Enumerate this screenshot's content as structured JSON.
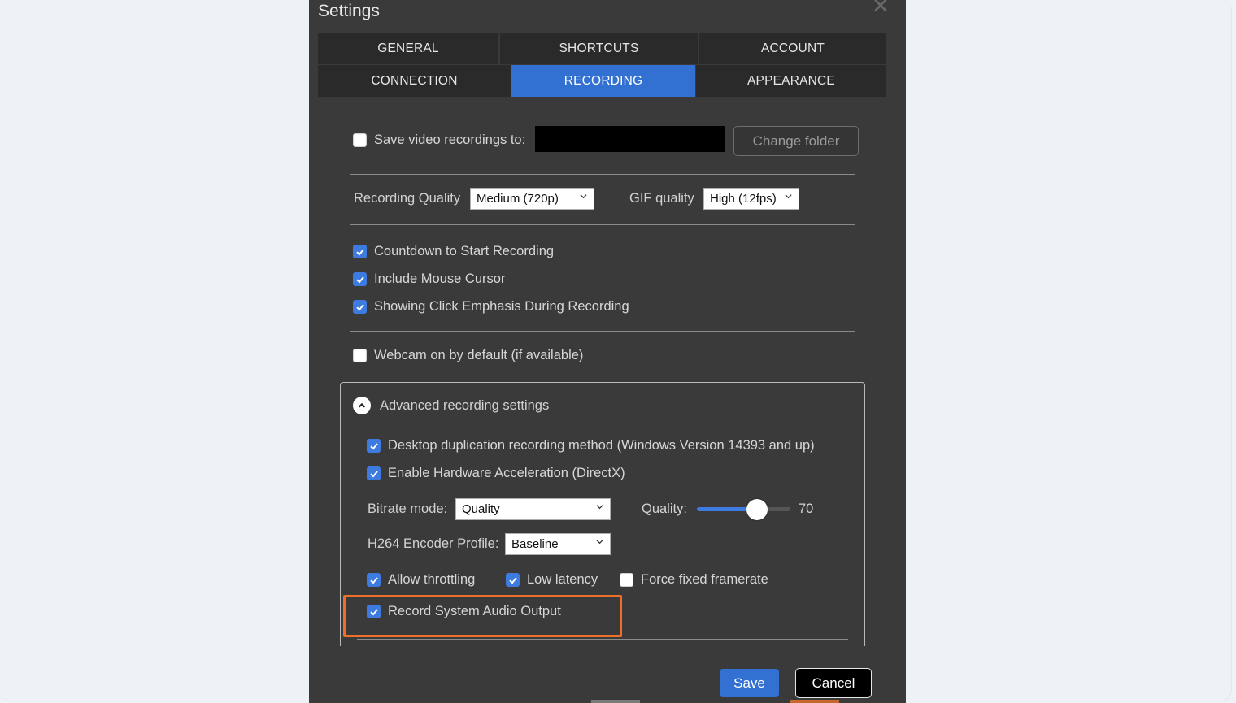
{
  "dialog": {
    "title": "Settings"
  },
  "tabs": [
    {
      "label": "GENERAL",
      "active": false
    },
    {
      "label": "SHORTCUTS",
      "active": false
    },
    {
      "label": "ACCOUNT",
      "active": false
    },
    {
      "label": "CONNECTION",
      "active": false
    },
    {
      "label": "RECORDING",
      "active": true
    },
    {
      "label": "APPEARANCE",
      "active": false
    }
  ],
  "save_path": {
    "label": "Save video recordings to:",
    "checked": false,
    "change_folder_label": "Change folder"
  },
  "quality": {
    "recording_label": "Recording Quality",
    "recording_value": "Medium (720p)",
    "gif_label": "GIF quality",
    "gif_value": "High (12fps)"
  },
  "options": {
    "countdown": {
      "label": "Countdown to Start Recording",
      "checked": true
    },
    "mouse_cursor": {
      "label": "Include Mouse Cursor",
      "checked": true
    },
    "click_emphasis": {
      "label": "Showing Click Emphasis During Recording",
      "checked": true
    },
    "webcam": {
      "label": "Webcam on by default (if available)",
      "checked": false
    }
  },
  "advanced": {
    "title": "Advanced recording settings",
    "desktop_duplication": {
      "label": "Desktop duplication recording method (Windows Version 14393 and up)",
      "checked": true
    },
    "hw_accel": {
      "label": "Enable Hardware Acceleration (DirectX)",
      "checked": true
    },
    "bitrate_label": "Bitrate mode:",
    "bitrate_value": "Quality",
    "quality_label": "Quality:",
    "quality_value": "70",
    "quality_fraction": 0.64,
    "encoder_label": "H264 Encoder Profile:",
    "encoder_value": "Baseline",
    "allow_throttling": {
      "label": "Allow throttling",
      "checked": true
    },
    "low_latency": {
      "label": "Low latency",
      "checked": true
    },
    "fixed_framerate": {
      "label": "Force fixed framerate",
      "checked": false
    },
    "system_audio": {
      "label": "Record System Audio Output",
      "checked": true
    }
  },
  "footer": {
    "save_label": "Save",
    "cancel_label": "Cancel"
  },
  "colors": {
    "accent": "#3270d2",
    "highlight": "#ec6f2a"
  }
}
